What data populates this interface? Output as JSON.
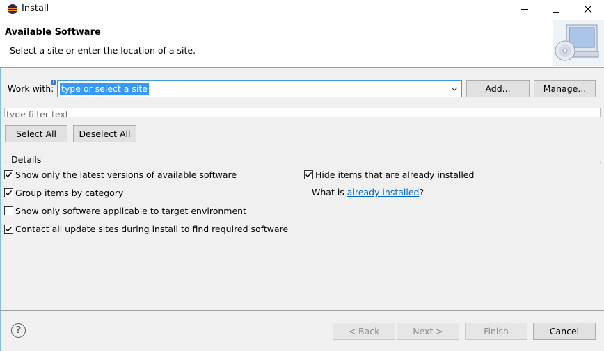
{
  "window": {
    "title": "Install"
  },
  "header": {
    "title": "Available Software",
    "description": "Select a site or enter the location of a site."
  },
  "work_with": {
    "label": "Work with:",
    "value": "type or select a site"
  },
  "buttons": {
    "add": "Add...",
    "manage": "Manage...",
    "select_all": "Select All",
    "deselect_all": "Deselect All",
    "back": "< Back",
    "next": "Next >",
    "finish": "Finish",
    "cancel": "Cancel"
  },
  "filter": {
    "placeholder": "type filter text"
  },
  "details": {
    "label": "Details",
    "options": [
      {
        "label": "Show only the latest versions of available software",
        "checked": true
      },
      {
        "label": "Group items by category",
        "checked": true
      },
      {
        "label": "Show only software applicable to target environment",
        "checked": false
      },
      {
        "label": "Contact all update sites during install to find required software",
        "checked": true
      },
      {
        "label": "Hide items that are already installed",
        "checked": true
      }
    ],
    "what_is_prefix": "What is ",
    "what_is_link": "already installed",
    "what_is_suffix": "?"
  },
  "icons": {
    "app": "eclipse-icon",
    "help": "help-icon",
    "info": "info-icon",
    "banner": "install-banner-icon"
  }
}
